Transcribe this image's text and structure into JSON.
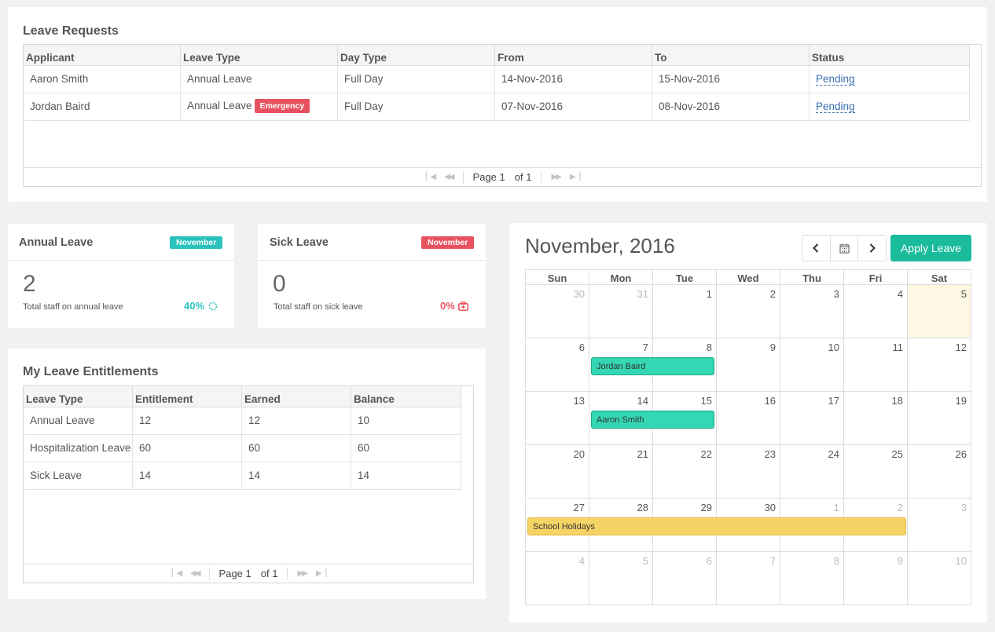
{
  "leave_requests": {
    "title": "Leave Requests",
    "columns": [
      "Applicant",
      "Leave Type",
      "Day Type",
      "From",
      "To",
      "Status"
    ],
    "rows": [
      {
        "applicant": "Aaron Smith",
        "leave_type": "Annual Leave",
        "badge": "",
        "day_type": "Full Day",
        "from": "14-Nov-2016",
        "to": "15-Nov-2016",
        "status": "Pending"
      },
      {
        "applicant": "Jordan Baird",
        "leave_type": "Annual Leave",
        "badge": "Emergency",
        "day_type": "Full Day",
        "from": "07-Nov-2016",
        "to": "08-Nov-2016",
        "status": "Pending"
      }
    ],
    "pager": {
      "page_label": "Page 1",
      "of_label": "of 1"
    }
  },
  "annual_card": {
    "title": "Annual Leave",
    "badge": "November",
    "count": "2",
    "subtitle": "Total staff on annual leave",
    "percent": "40%",
    "color": "#29c2bd",
    "badge_color": "#29c2bd",
    "icon": "spinner-icon"
  },
  "sick_card": {
    "title": "Sick Leave",
    "badge": "November",
    "count": "0",
    "subtitle": "Total staff on sick leave",
    "percent": "0%",
    "color": "#e8515e",
    "badge_color": "#e8515e",
    "icon": "medkit-icon"
  },
  "entitlements": {
    "title": "My Leave Entitlements",
    "columns": [
      "Leave Type",
      "Entitlement",
      "Earned",
      "Balance"
    ],
    "rows": [
      {
        "type": "Annual Leave",
        "entitlement": "12",
        "earned": "12",
        "balance": "10"
      },
      {
        "type": "Hospitalization Leave",
        "entitlement": "60",
        "earned": "60",
        "balance": "60"
      },
      {
        "type": "Sick Leave",
        "entitlement": "14",
        "earned": "14",
        "balance": "14"
      }
    ],
    "pager": {
      "page_label": "Page 1",
      "of_label": "of 1"
    }
  },
  "calendar": {
    "title": "November, 2016",
    "apply_label": "Apply Leave",
    "accent": "#1abc9c",
    "days_of_week": [
      "Sun",
      "Mon",
      "Tue",
      "Wed",
      "Thu",
      "Fri",
      "Sat"
    ],
    "weeks": [
      [
        "30",
        "31",
        "1",
        "2",
        "3",
        "4",
        "5"
      ],
      [
        "6",
        "7",
        "8",
        "9",
        "10",
        "11",
        "12"
      ],
      [
        "13",
        "14",
        "15",
        "16",
        "17",
        "18",
        "19"
      ],
      [
        "20",
        "21",
        "22",
        "23",
        "24",
        "25",
        "26"
      ],
      [
        "27",
        "28",
        "29",
        "30",
        "1",
        "2",
        "3"
      ],
      [
        "4",
        "5",
        "6",
        "7",
        "8",
        "9",
        "10"
      ]
    ],
    "events": [
      {
        "label": "Jordan Baird",
        "color": "green"
      },
      {
        "label": "Aaron Smith",
        "color": "green"
      },
      {
        "label": "School Holidays",
        "color": "yellow"
      }
    ]
  }
}
